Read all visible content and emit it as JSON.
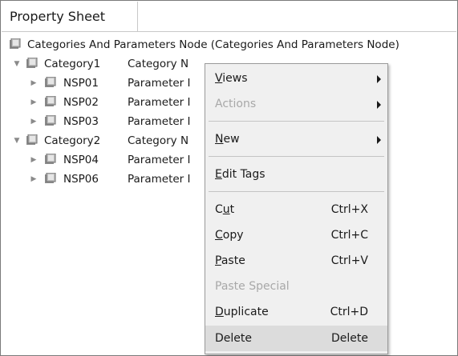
{
  "tab": {
    "label": "Property Sheet"
  },
  "root": {
    "label": "Categories And Parameters Node  (Categories And Parameters Node)"
  },
  "tree": [
    {
      "label": "Category1",
      "type": "Category N",
      "level": 1,
      "expanded": true
    },
    {
      "label": "NSP01",
      "type": "Parameter I",
      "level": 2,
      "expanded": false
    },
    {
      "label": "NSP02",
      "type": "Parameter I",
      "level": 2,
      "expanded": false
    },
    {
      "label": "NSP03",
      "type": "Parameter I",
      "level": 2,
      "expanded": false
    },
    {
      "label": "Category2",
      "type": "Category N",
      "level": 1,
      "expanded": true
    },
    {
      "label": "NSP04",
      "type": "Parameter I",
      "level": 2,
      "expanded": false
    },
    {
      "label": "NSP06",
      "type": "Parameter I",
      "level": 2,
      "expanded": false
    }
  ],
  "menu": {
    "views": {
      "mnemonic": "V",
      "rest": "iews"
    },
    "actions": {
      "label": "Actions"
    },
    "new": {
      "mnemonic": "N",
      "rest": "ew"
    },
    "edit_tags": {
      "mnemonic": "E",
      "rest": "dit Tags"
    },
    "cut": {
      "pre": "C",
      "mnemonic": "u",
      "rest": "t",
      "shortcut": "Ctrl+X"
    },
    "copy": {
      "mnemonic": "C",
      "rest": "opy",
      "shortcut": "Ctrl+C"
    },
    "paste": {
      "mnemonic": "P",
      "rest": "aste",
      "shortcut": "Ctrl+V"
    },
    "paste_special": {
      "label": "Paste Special"
    },
    "duplicate": {
      "mnemonic": "D",
      "rest": "uplicate",
      "shortcut": "Ctrl+D"
    },
    "delete": {
      "label": "Delete",
      "shortcut": "Delete"
    }
  },
  "colors": {
    "menu_bg": "#f0f0f0",
    "highlight": "#dcdcdc",
    "disabled_text": "#a8a8a8"
  }
}
